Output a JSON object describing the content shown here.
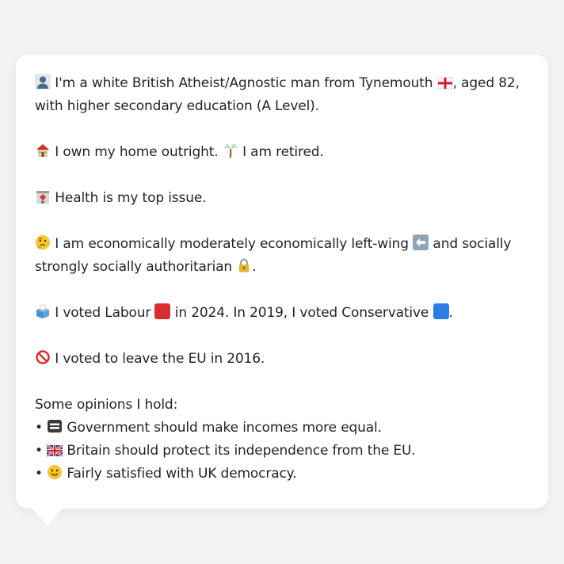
{
  "profile": {
    "identity": {
      "icon": "bust-in-silhouette-icon",
      "text_before": "I'm a white British Atheist/Agnostic man from Tynemouth",
      "flag_icon": "england-flag-icon",
      "text_after": ", aged 82, with higher secondary education (A Level)."
    },
    "home": {
      "house_icon": "house-icon",
      "text1": "I own my home outright.",
      "palm_icon": "palm-tree-icon",
      "text2": "I am retired."
    },
    "issue": {
      "icon": "hospital-icon",
      "text": "Health is my top issue."
    },
    "ideology": {
      "icon": "thinking-face-icon",
      "text1": "I am economically moderately economically left-wing",
      "left_icon": "left-arrow-icon",
      "text2": "and socially strongly socially authoritarian",
      "lock_icon": "lock-icon",
      "text3": "."
    },
    "vote": {
      "icon": "ballot-box-icon",
      "text1": "I voted Labour",
      "labour_color": "#d62f2f",
      "text2": "in 2024. In 2019, I voted Conservative",
      "conservative_color": "#2f7de1",
      "text3": "."
    },
    "brexit": {
      "icon": "prohibited-icon",
      "text": "I voted to leave the EU in 2016."
    },
    "opinions": {
      "heading": "Some opinions I hold:",
      "items": [
        {
          "bullet": "•",
          "icon": "equals-icon",
          "text": "Government should make incomes more equal."
        },
        {
          "bullet": "•",
          "icon": "uk-flag-icon",
          "text": "Britain should protect its independence from the EU."
        },
        {
          "bullet": "•",
          "icon": "slightly-smiling-face-icon",
          "text": "Fairly satisfied with UK democracy."
        }
      ]
    }
  }
}
